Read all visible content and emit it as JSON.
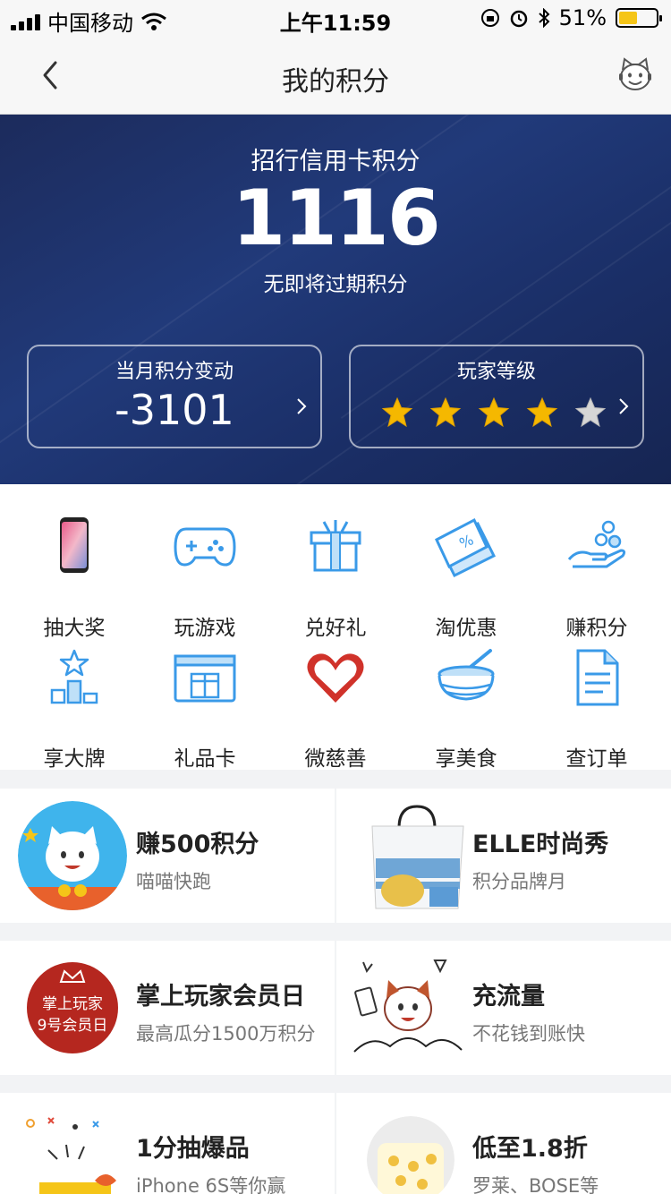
{
  "status_bar": {
    "carrier": "中国移动",
    "time": "上午11:59",
    "battery_percent": "51%",
    "battery_level": 0.51
  },
  "nav": {
    "title": "我的积分"
  },
  "hero": {
    "title": "招行信用卡积分",
    "points": "1116",
    "subtitle": "无即将过期积分",
    "monthly_change_label": "当月积分变动",
    "monthly_change_value": "-3101",
    "level_label": "玩家等级",
    "level_stars": 4,
    "level_stars_max": 5
  },
  "grid": [
    {
      "label": "抽大奖",
      "icon": "phone-icon"
    },
    {
      "label": "玩游戏",
      "icon": "gamepad-icon"
    },
    {
      "label": "兑好礼",
      "icon": "gift-icon"
    },
    {
      "label": "淘优惠",
      "icon": "coupon-icon"
    },
    {
      "label": "赚积分",
      "icon": "coins-hand-icon"
    },
    {
      "label": "享大牌",
      "icon": "podium-star-icon"
    },
    {
      "label": "礼品卡",
      "icon": "gift-card-icon"
    },
    {
      "label": "微慈善",
      "icon": "heart-icon"
    },
    {
      "label": "享美食",
      "icon": "bowl-icon"
    },
    {
      "label": "查订单",
      "icon": "document-icon"
    }
  ],
  "cards": [
    {
      "title": "赚500积分",
      "subtitle": "喵喵快跑"
    },
    {
      "title": "ELLE时尚秀",
      "subtitle": "积分品牌月"
    },
    {
      "title": "掌上玩家会员日",
      "subtitle": "最高瓜分1500万积分",
      "badge_line1": "掌上玩家",
      "badge_line2": "9号会员日"
    },
    {
      "title": "充流量",
      "subtitle": "不花钱到账快"
    },
    {
      "title": "1分抽爆品",
      "subtitle": "iPhone 6S等你赢"
    },
    {
      "title": "低至1.8折",
      "subtitle": "罗莱、BOSE等"
    }
  ],
  "colors": {
    "hero_bg": "#1f3470",
    "icon_blue": "#3a9ae8",
    "heart_red": "#d0322a",
    "star_gold": "#f5b800",
    "badge_red": "#b5271f"
  }
}
